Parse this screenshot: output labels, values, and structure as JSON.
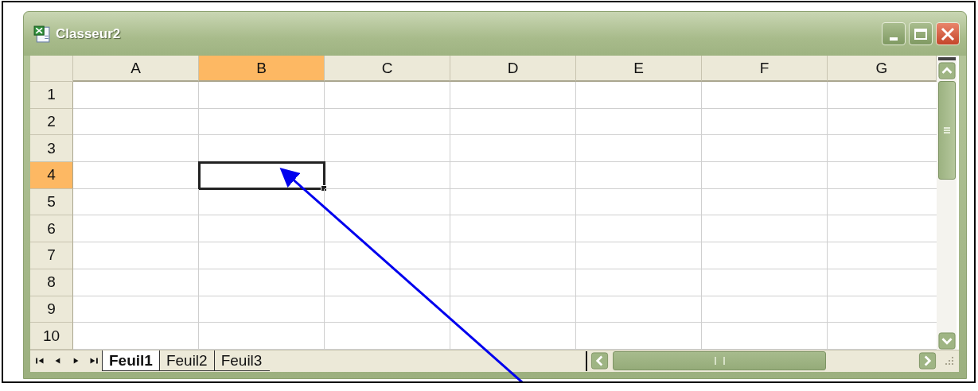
{
  "window": {
    "title": "Classeur2"
  },
  "columns": [
    {
      "label": "A",
      "selected": false
    },
    {
      "label": "B",
      "selected": true
    },
    {
      "label": "C",
      "selected": false
    },
    {
      "label": "D",
      "selected": false
    },
    {
      "label": "E",
      "selected": false
    },
    {
      "label": "F",
      "selected": false
    },
    {
      "label": "G",
      "selected": false
    }
  ],
  "rows": [
    {
      "label": "1",
      "selected": false
    },
    {
      "label": "2",
      "selected": false
    },
    {
      "label": "3",
      "selected": false
    },
    {
      "label": "4",
      "selected": true
    },
    {
      "label": "5",
      "selected": false
    },
    {
      "label": "6",
      "selected": false
    },
    {
      "label": "7",
      "selected": false
    },
    {
      "label": "8",
      "selected": false
    },
    {
      "label": "9",
      "selected": false
    },
    {
      "label": "10",
      "selected": false
    }
  ],
  "sheet_tabs": [
    {
      "label": "Feuil1",
      "selected": true
    },
    {
      "label": "Feuil2",
      "selected": false
    },
    {
      "label": "Feuil3",
      "selected": false
    }
  ]
}
